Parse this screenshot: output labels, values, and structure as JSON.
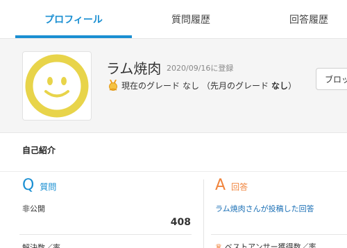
{
  "tabs": [
    {
      "label": "プロフィール",
      "active": true
    },
    {
      "label": "質問履歴",
      "active": false
    },
    {
      "label": "回答履歴",
      "active": false
    }
  ],
  "profile": {
    "avatar_icon": "smiley-face-icon",
    "name": "ラム焼肉",
    "registered": "2020/09/16に登録",
    "grade_icon": "grade-medal-icon",
    "grade_prefix": "現在のグレード",
    "grade_value": "なし",
    "last_month_prefix": "（先月のグレード",
    "last_month_value": "なし",
    "last_month_suffix": "）",
    "block_button": "ブロック"
  },
  "intro": {
    "title": "自己紹介"
  },
  "questions": {
    "letter": "Q",
    "label": "質問",
    "visibility": "非公開",
    "count": "408",
    "next_label": "解決数／率"
  },
  "answers": {
    "letter": "A",
    "label": "回答",
    "link": "ラム焼肉さんが投稿した回答",
    "best_icon": "ribbon-icon",
    "next_label": "ベストアンサー獲得数／率"
  },
  "colors": {
    "accent": "#1a8fd2",
    "answer": "#f0843c",
    "avatar": "#e8d44a"
  }
}
